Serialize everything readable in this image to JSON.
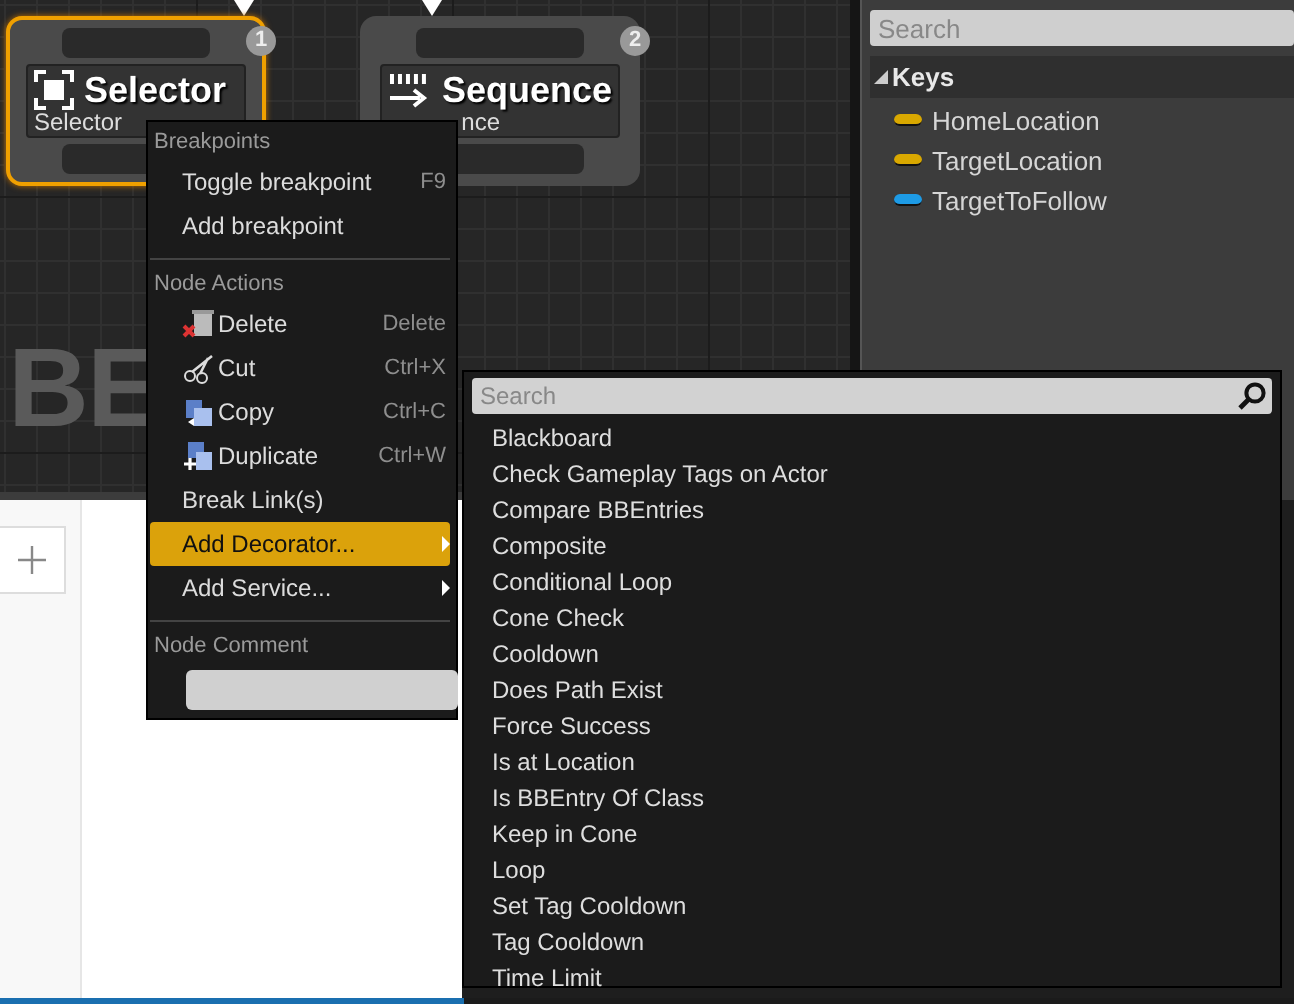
{
  "graph": {
    "canvas_label": "BE",
    "nodes": [
      {
        "title": "Selector",
        "subtitle": "Selector",
        "badge": "1",
        "selected": true,
        "kind": "selector"
      },
      {
        "title": "Sequence",
        "subtitle": "nce",
        "badge": "2",
        "selected": false,
        "kind": "sequence"
      }
    ]
  },
  "blackboard": {
    "search": {
      "placeholder": "Search"
    },
    "section": {
      "label": "Keys",
      "expanded": true
    },
    "keys": [
      {
        "name": "HomeLocation",
        "color": "#d9a800"
      },
      {
        "name": "TargetLocation",
        "color": "#d9a800"
      },
      {
        "name": "TargetToFollow",
        "color": "#1d9be6"
      }
    ]
  },
  "context_menu": {
    "items": [
      {
        "kind": "header",
        "label": "Breakpoints"
      },
      {
        "kind": "item",
        "label": "Toggle breakpoint",
        "shortcut": "F9",
        "selected": false,
        "submenu": false
      },
      {
        "kind": "item",
        "label": "Add breakpoint",
        "selected": false,
        "submenu": false
      },
      {
        "kind": "separator"
      },
      {
        "kind": "header",
        "label": "Node Actions"
      },
      {
        "kind": "action",
        "label": "Delete",
        "shortcut": "Delete",
        "selected": false,
        "submenu": false
      },
      {
        "kind": "action",
        "label": "Cut",
        "shortcut": "Ctrl+X",
        "selected": false,
        "submenu": false
      },
      {
        "kind": "action",
        "label": "Copy",
        "shortcut": "Ctrl+C",
        "selected": false,
        "submenu": false
      },
      {
        "kind": "action",
        "label": "Duplicate",
        "shortcut": "Ctrl+W",
        "selected": false,
        "submenu": false
      },
      {
        "kind": "item",
        "label": "Break Link(s)",
        "selected": false,
        "submenu": false
      },
      {
        "kind": "item",
        "label": "Add Decorator...",
        "selected": true,
        "submenu": true
      },
      {
        "kind": "item",
        "label": "Add Service...",
        "selected": false,
        "submenu": true
      },
      {
        "kind": "separator"
      },
      {
        "kind": "header",
        "label": "Node Comment"
      },
      {
        "kind": "field"
      }
    ]
  },
  "decorator_menu": {
    "search": {
      "placeholder": "Search"
    },
    "items": [
      "Blackboard",
      "Check Gameplay Tags on Actor",
      "Compare BBEntries",
      "Composite",
      "Conditional Loop",
      "Cone Check",
      "Cooldown",
      "Does Path Exist",
      "Force Success",
      "Is at Location",
      "Is BBEntry Of Class",
      "Keep in Cone",
      "Loop",
      "Set Tag Cooldown",
      "Tag Cooldown",
      "Time Limit"
    ]
  }
}
